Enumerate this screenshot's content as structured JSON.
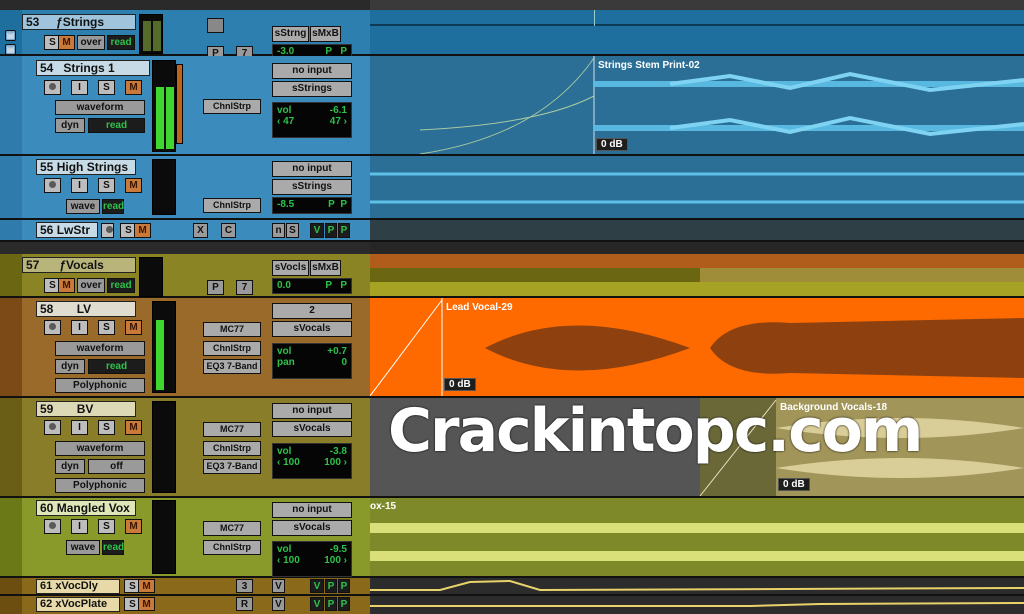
{
  "folders": {
    "strings": {
      "number": "53",
      "name": "ƒStrings",
      "btn_s": "S",
      "btn_m": "M",
      "over": "over",
      "read": "read",
      "p": "P",
      "seven": "7",
      "io_a": "sStrng",
      "io_b": "sMxB",
      "vol": "-3.0",
      "p1": "P",
      "p2": "P",
      "color": "#1f6f9e"
    },
    "vocals": {
      "number": "57",
      "name": "ƒVocals",
      "btn_s": "S",
      "btn_m": "M",
      "over": "over",
      "read": "read",
      "p": "P",
      "seven": "7",
      "io_a": "sVocls",
      "io_b": "sMxB",
      "vol": "0.0",
      "p1": "P",
      "p2": "P",
      "color": "#7a7416"
    }
  },
  "tracks": [
    {
      "number": "54",
      "name": "Strings 1",
      "view": "waveform",
      "dyn": "dyn",
      "auto": "read",
      "inserts": [
        "ChnlStrp"
      ],
      "input": "no input",
      "output": "sStrings",
      "vol_label": "vol",
      "vol": "-6.1",
      "pan_l": "‹ 47",
      "pan_r": "47 ›"
    },
    {
      "number": "55",
      "name": "High Strings",
      "view": "wave",
      "auto": "read",
      "inserts": [
        "ChnlStrp"
      ],
      "input": "no input",
      "output": "sStrings",
      "vol": "-8.5",
      "p1": "P",
      "p2": "P"
    },
    {
      "number": "56",
      "name": "LwStr",
      "btn_s": "S",
      "btn_m": "M",
      "x": "X",
      "c": "C",
      "n": "n",
      "s2": "S",
      "v": "V",
      "p1": "P",
      "p2": "P"
    },
    {
      "number": "58",
      "name": "LV",
      "view": "waveform",
      "dyn": "dyn",
      "auto": "read",
      "inserts": [
        "MC77",
        "ChnlStrp",
        "EQ3 7-Band"
      ],
      "input": "2",
      "output": "sVocals",
      "vol_label": "vol",
      "vol": "+0.7",
      "pan_label": "pan",
      "pan": "0",
      "extra": "Polyphonic"
    },
    {
      "number": "59",
      "name": "BV",
      "view": "waveform",
      "dyn": "dyn",
      "auto": "off",
      "inserts": [
        "MC77",
        "ChnlStrp",
        "EQ3 7-Band"
      ],
      "input": "no input",
      "output": "sVocals",
      "vol_label": "vol",
      "vol": "-3.8",
      "pan_l": "‹ 100",
      "pan_r": "100 ›",
      "extra": "Polyphonic"
    },
    {
      "number": "60",
      "name": "Mangled Vox",
      "view": "wave",
      "auto": "read",
      "inserts": [
        "MC77",
        "ChnlStrp"
      ],
      "input": "no input",
      "output": "sVocals",
      "vol_label": "vol",
      "vol": "-9.5",
      "pan_l": "‹ 100",
      "pan_r": "100 ›"
    },
    {
      "number": "61",
      "name": "xVocDly",
      "btn_s": "S",
      "btn_m": "M",
      "num": "3",
      "v": "V",
      "p1": "P",
      "p2": "P"
    },
    {
      "number": "62",
      "name": "xVocPlate",
      "btn_s": "S",
      "btn_m": "M",
      "num": "R",
      "v": "V",
      "p1": "P",
      "p2": "P"
    }
  ],
  "buttons": {
    "i": "I",
    "s": "S",
    "m": "M"
  },
  "clips": {
    "strings": {
      "name": "Strings Stem Print-02",
      "gain": "0 dB"
    },
    "lead": {
      "name": "Lead Vocal-29",
      "gain": "0 dB"
    },
    "bg": {
      "name": "Background Vocals-18",
      "gain": "0 dB"
    },
    "mangled": {
      "name": "ox-15"
    }
  },
  "watermark": "Crackintopc.com",
  "colors": {
    "strings": "#1f6f9e",
    "vocals_folder": "#7a7416",
    "lead": "#ff6a00",
    "bv": "#8a7d2a",
    "mangled": "#7e8a2a"
  }
}
